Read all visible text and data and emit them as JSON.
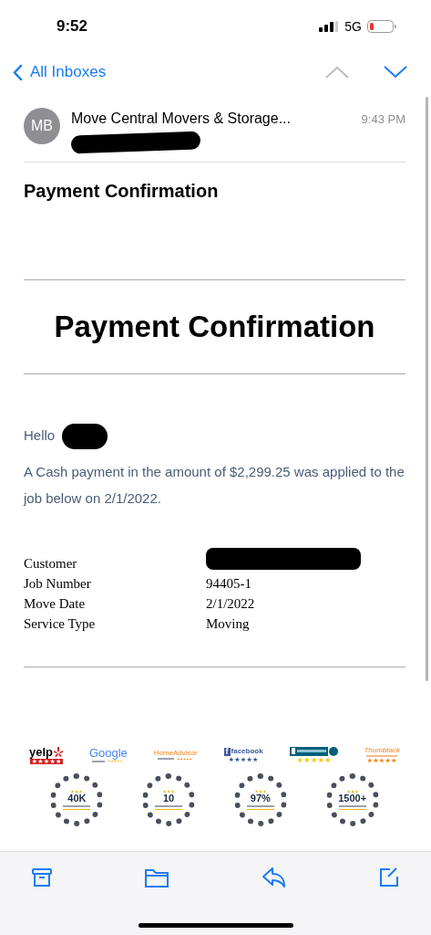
{
  "status_bar": {
    "time": "9:52",
    "network": "5G"
  },
  "nav": {
    "back_label": "All Inboxes"
  },
  "message": {
    "avatar_initials": "MB",
    "sender": "Move Central Movers & Storage...",
    "time": "9:43 PM",
    "subject": "Payment Confirmation"
  },
  "email_body": {
    "heading": "Payment Confirmation",
    "greeting": "Hello",
    "paragraph": "A Cash payment in the amount of $2,299.25 was applied to the job below on 2/1/2022.",
    "details": [
      {
        "label": "Customer",
        "redacted": true
      },
      {
        "label": "Job Number",
        "value": "94405-1",
        "redacted": false
      },
      {
        "label": "Move Date",
        "value": "2/1/2022",
        "redacted": false
      },
      {
        "label": "Service Type",
        "value": "Moving",
        "redacted": false
      }
    ],
    "review_logos": [
      {
        "kind": "yelp",
        "name": "yelp"
      },
      {
        "kind": "google",
        "name": "Google"
      },
      {
        "kind": "homeadvisor",
        "name": "HomeAdvisor"
      },
      {
        "kind": "facebook",
        "name": "facebook",
        "mark": "f"
      },
      {
        "kind": "bbb"
      },
      {
        "kind": "thumbtack",
        "name": "Thumbtack"
      }
    ],
    "badges": [
      {
        "value": "40K"
      },
      {
        "value": "10"
      },
      {
        "value": "97%"
      },
      {
        "value": "1500+"
      }
    ]
  }
}
